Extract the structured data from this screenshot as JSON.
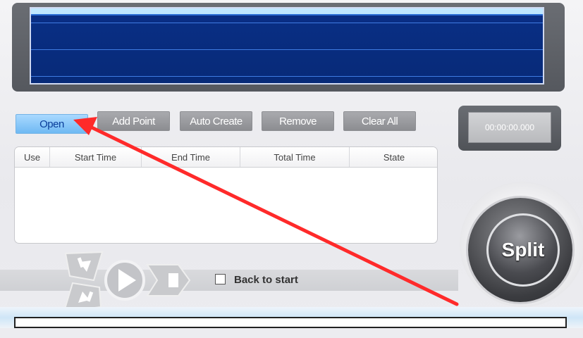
{
  "toolbar": {
    "open_label": "Open",
    "add_point_label": "Add Point",
    "auto_create_label": "Auto Create",
    "remove_label": "Remove",
    "clear_all_label": "Clear All"
  },
  "time_display": "00:00:00.000",
  "table": {
    "columns": [
      "Use",
      "Start  Time",
      "End  Time",
      "Total  Time",
      "State"
    ],
    "rows": []
  },
  "controls": {
    "back_to_start_label": "Back to start",
    "back_to_start_checked": false
  },
  "split_label": "Split",
  "progress": 0,
  "colors": {
    "wave_background": "#0a2f86",
    "open_button": "#8cc8f7",
    "annotation_arrow": "#ff2a2a"
  }
}
